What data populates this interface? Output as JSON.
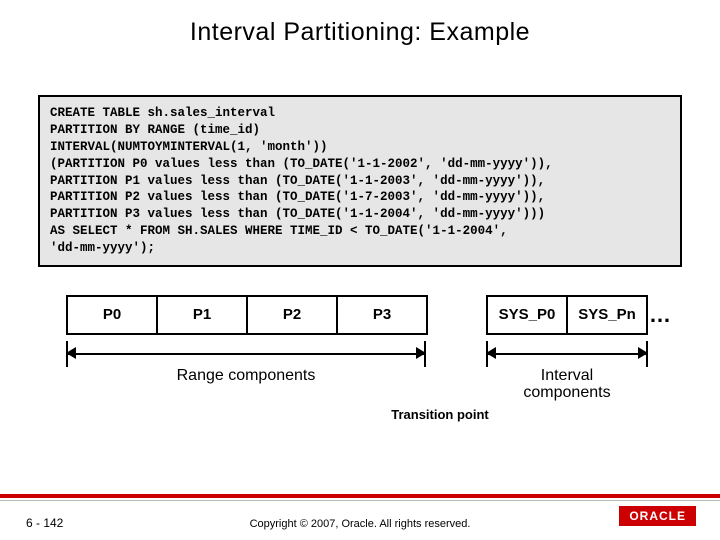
{
  "title": "Interval Partitioning: Example",
  "code": "CREATE TABLE sh.sales_interval\nPARTITION BY RANGE (time_id)\nINTERVAL(NUMTOYMINTERVAL(1, 'month'))\n(PARTITION P0 values less than (TO_DATE('1-1-2002', 'dd-mm-yyyy')),\nPARTITION P1 values less than (TO_DATE('1-1-2003', 'dd-mm-yyyy')),\nPARTITION P2 values less than (TO_DATE('1-7-2003', 'dd-mm-yyyy')),\nPARTITION P3 values less than (TO_DATE('1-1-2004', 'dd-mm-yyyy')))\nAS SELECT * FROM SH.SALES WHERE TIME_ID < TO_DATE('1-1-2004',\n'dd-mm-yyyy');",
  "partitions": {
    "p0": "P0",
    "p1": "P1",
    "p2": "P2",
    "p3": "P3",
    "sys_first": "SYS_P0",
    "sys_last": "SYS_Pn",
    "ellipsis": "…"
  },
  "labels": {
    "range": "Range components",
    "interval": "Interval\ncomponents",
    "transition": "Transition point"
  },
  "footer": {
    "page": "6 - 142",
    "copyright": "Copyright © 2007, Oracle. All rights reserved.",
    "logo": "ORACLE"
  }
}
